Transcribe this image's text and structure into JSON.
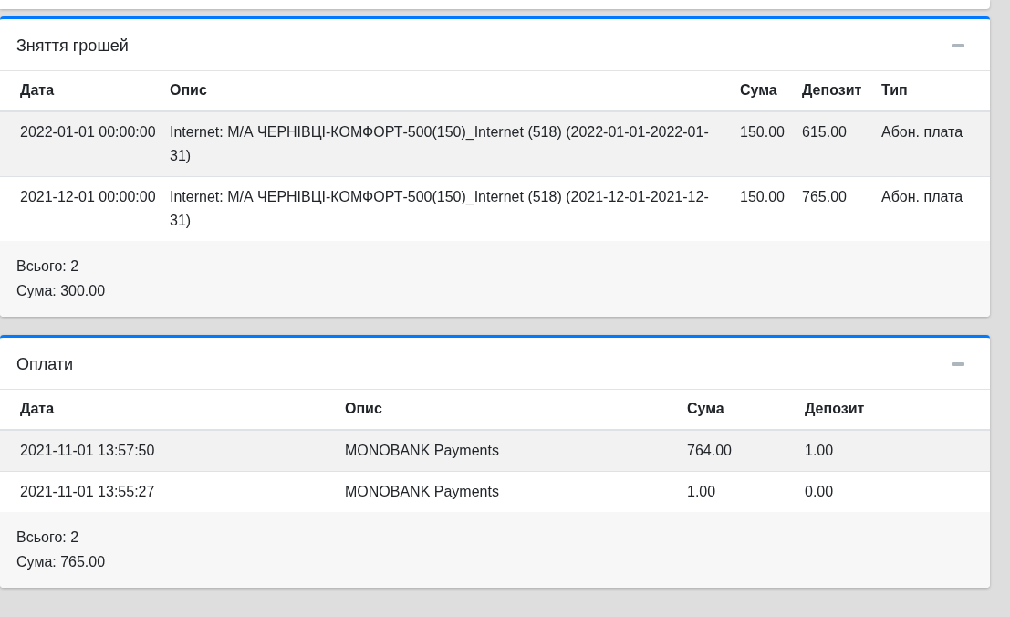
{
  "panels": [
    {
      "title": "Зняття грошей",
      "expanded": true,
      "columns": [
        "Дата",
        "Опис",
        "Сума",
        "Депозит",
        "Тип"
      ],
      "rows": [
        [
          "2022-01-01 00:00:00",
          "Internet: М/А ЧЕРНІВЦІ-КОМФОРТ-500(150)_Internet (518) (2022-01-01-2022-01-31)",
          "150.00",
          "615.00",
          "Абон. плата"
        ],
        [
          "2021-12-01 00:00:00",
          "Internet: М/А ЧЕРНІВЦІ-КОМФОРТ-500(150)_Internet (518) (2021-12-01-2021-12-31)",
          "150.00",
          "765.00",
          "Абон. плата"
        ]
      ],
      "footer": [
        "Всього: 2",
        "Сума: 300.00"
      ]
    },
    {
      "title": "Оплати",
      "expanded": true,
      "columns": [
        "Дата",
        "Опис",
        "Сума",
        "Депозит"
      ],
      "rows": [
        [
          "2021-11-01 13:57:50",
          "MONOBANK Payments",
          "764.00",
          "1.00"
        ],
        [
          "2021-11-01 13:55:27",
          "MONOBANK Payments",
          "1.00",
          "0.00"
        ]
      ],
      "footer": [
        "Всього: 2",
        "Сума: 765.00"
      ]
    }
  ]
}
